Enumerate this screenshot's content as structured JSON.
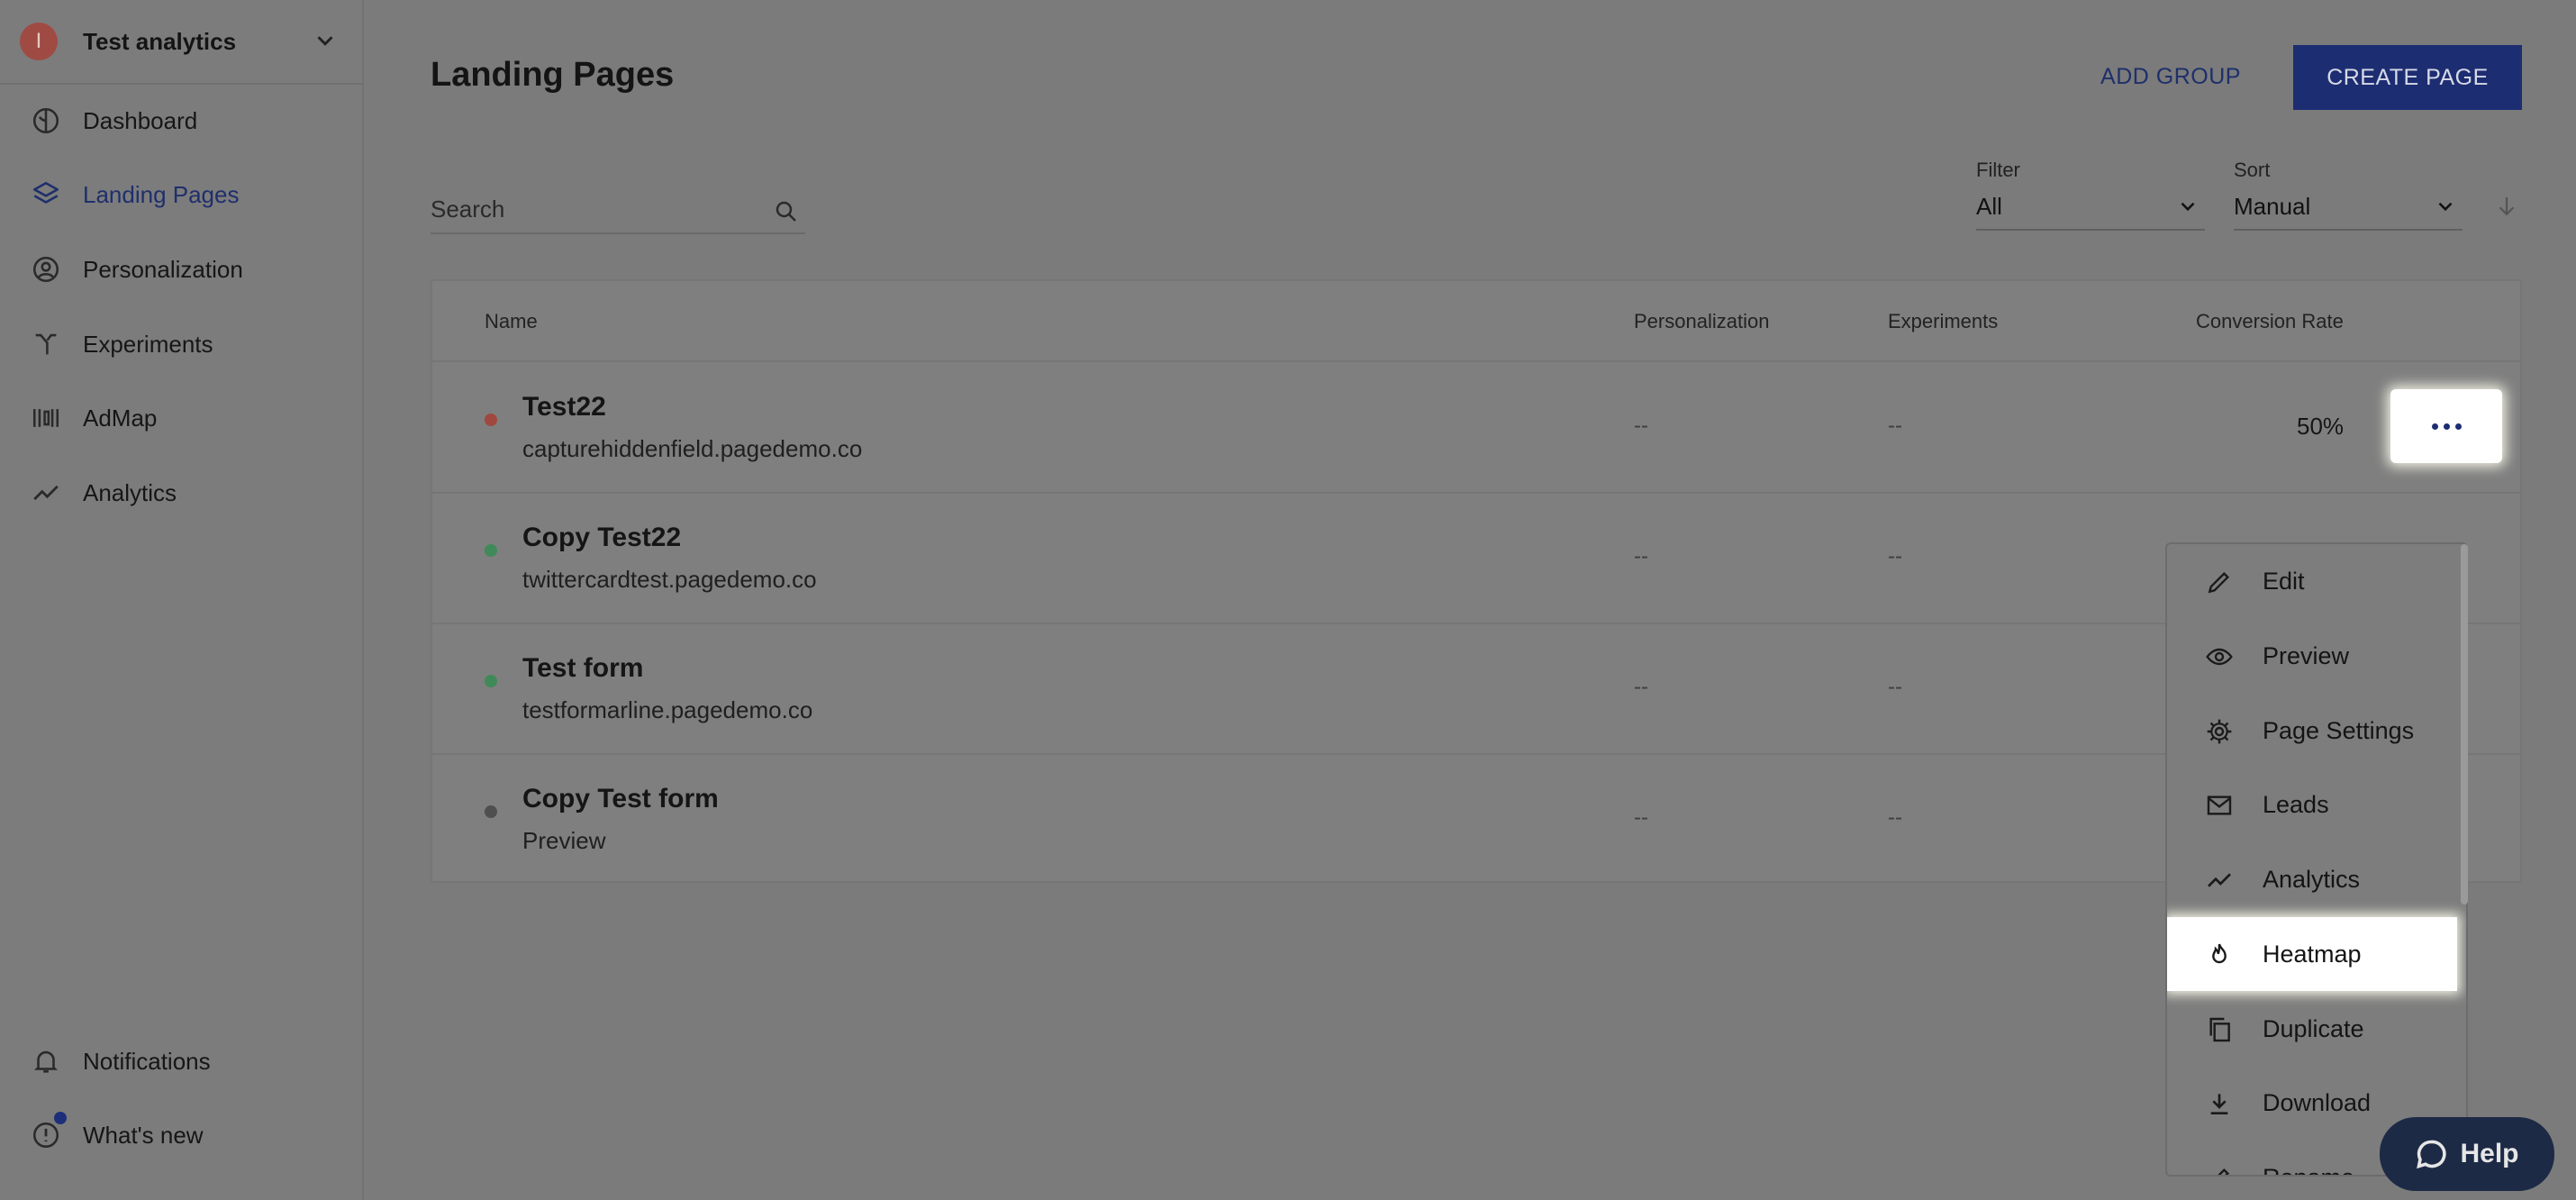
{
  "workspace": {
    "avatar_letter": "I",
    "name": "Test analytics"
  },
  "sidebar": {
    "items": [
      {
        "label": "Dashboard",
        "icon": "dashboard-icon"
      },
      {
        "label": "Landing Pages",
        "icon": "layers-icon",
        "active": true
      },
      {
        "label": "Personalization",
        "icon": "user-circle-icon"
      },
      {
        "label": "Experiments",
        "icon": "split-icon"
      },
      {
        "label": "AdMap",
        "icon": "admap-icon"
      },
      {
        "label": "Analytics",
        "icon": "trend-icon"
      }
    ],
    "bottom": [
      {
        "label": "Notifications",
        "icon": "bell-icon"
      },
      {
        "label": "What's new",
        "icon": "info-icon"
      }
    ]
  },
  "header": {
    "title": "Landing Pages",
    "add_group_label": "ADD GROUP",
    "create_page_label": "CREATE PAGE"
  },
  "search": {
    "placeholder": "Search"
  },
  "filter": {
    "label": "Filter",
    "value": "All"
  },
  "sort": {
    "label": "Sort",
    "value": "Manual"
  },
  "table": {
    "columns": [
      "Name",
      "Personalization",
      "Experiments",
      "Conversion Rate"
    ],
    "rows": [
      {
        "title": "Test22",
        "url": "capturehiddenfield.pagedemo.co",
        "status_color": "#a0473f",
        "personalization": "--",
        "experiments": "--",
        "conversion": "50%"
      },
      {
        "title": "Copy Test22",
        "url": "twittercardtest.pagedemo.co",
        "status_color": "#3f8a58",
        "personalization": "--",
        "experiments": "--",
        "conversion": ""
      },
      {
        "title": "Test form",
        "url": "testformarline.pagedemo.co",
        "status_color": "#3f8a58",
        "personalization": "--",
        "experiments": "--",
        "conversion": ""
      },
      {
        "title": "Copy Test form",
        "url": "Preview",
        "status_color": "#4f4f4f",
        "personalization": "--",
        "experiments": "--",
        "conversion": ""
      }
    ]
  },
  "menu": {
    "items": [
      {
        "label": "Edit",
        "icon": "pencil-icon"
      },
      {
        "label": "Preview",
        "icon": "eye-icon"
      },
      {
        "label": "Page Settings",
        "icon": "gear-icon"
      },
      {
        "label": "Leads",
        "icon": "mail-icon"
      },
      {
        "label": "Analytics",
        "icon": "trend-icon"
      },
      {
        "label": "Heatmap",
        "icon": "flame-icon",
        "highlighted": true
      },
      {
        "label": "Duplicate",
        "icon": "copy-icon"
      },
      {
        "label": "Download",
        "icon": "download-icon"
      },
      {
        "label": "Rename",
        "icon": "pencil-icon"
      }
    ]
  },
  "help": {
    "label": "Help"
  }
}
